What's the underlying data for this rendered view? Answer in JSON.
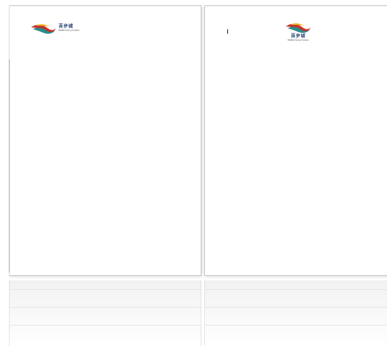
{
  "brand": {
    "name_cn": "百步城",
    "name_en": "BaiBuCheng Outlets",
    "colors": {
      "red": "#c8322a",
      "yellow": "#e8b523",
      "teal": "#2a8a8a",
      "navy": "#1f3b6d"
    }
  },
  "pages": [
    {
      "label": "page-1",
      "logo": "brand-logo-icon"
    },
    {
      "label": "page-2",
      "logo": "brand-logo-icon"
    }
  ]
}
